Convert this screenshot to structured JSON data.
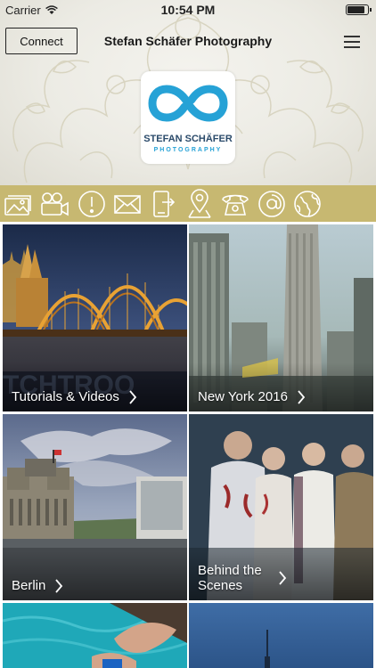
{
  "status_bar": {
    "carrier": "Carrier",
    "time": "10:54 PM"
  },
  "header": {
    "connect_label": "Connect",
    "title": "Stefan Schäfer Photography",
    "logo_name": "STEFAN SCHÄFER",
    "logo_sub": "PHOTOGRAPHY"
  },
  "colors": {
    "icon_bar": "#c7b871",
    "logo_blue": "#26a2d6"
  },
  "toolbar_icons": [
    "gallery-icon",
    "video-icon",
    "info-icon",
    "mail-icon",
    "mobile-share-icon",
    "location-icon",
    "phone-icon",
    "at-icon",
    "globe-icon"
  ],
  "tiles": [
    {
      "caption": "Tutorials & Videos"
    },
    {
      "caption": "New York 2016"
    },
    {
      "caption": "Berlin"
    },
    {
      "caption": "Behind the Scenes"
    },
    {
      "caption": ""
    },
    {
      "caption": ""
    }
  ]
}
